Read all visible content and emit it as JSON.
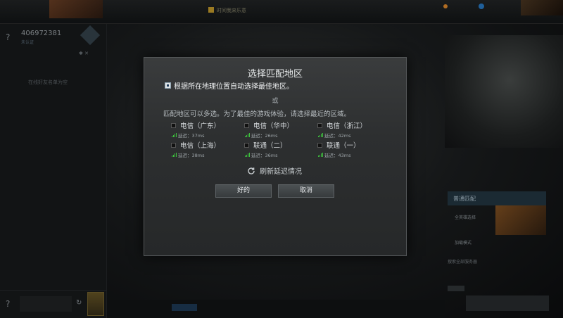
{
  "background": {
    "top_center_label": "时间我来乐意",
    "left_panel": {
      "help_icon": "?",
      "user_id": "406972381",
      "user_sub": "未认证",
      "empty_text": "在线好友名单为空",
      "bottom_help_icon": "?"
    },
    "right_panel": {
      "matchmaking_title": "普通匹配",
      "option1": "全英雄选择",
      "option2": "加载模式",
      "option3": "搜索全部服务器"
    }
  },
  "dialog": {
    "title": "选择匹配地区",
    "auto_select_label": "根据所在地理位置自动选择最佳地区。",
    "auto_select_checked": true,
    "or_label": "或",
    "info_text": "匹配地区可以多选。为了最佳的游戏体验，请选择最近的区域。",
    "regions": [
      {
        "name": "电信（广东）",
        "latency": "延迟：37ms",
        "checked": false
      },
      {
        "name": "电信（华中）",
        "latency": "延迟：26ms",
        "checked": false
      },
      {
        "name": "电信（浙江）",
        "latency": "延迟：42ms",
        "checked": false
      },
      {
        "name": "电信（上海）",
        "latency": "延迟：38ms",
        "checked": false
      },
      {
        "name": "联通（二）",
        "latency": "延迟：36ms",
        "checked": false
      },
      {
        "name": "联通（一）",
        "latency": "延迟：43ms",
        "checked": false
      }
    ],
    "refresh_label": "刷新延迟情况",
    "ok_label": "好的",
    "cancel_label": "取消",
    "signal_color": "#3ec43e"
  }
}
